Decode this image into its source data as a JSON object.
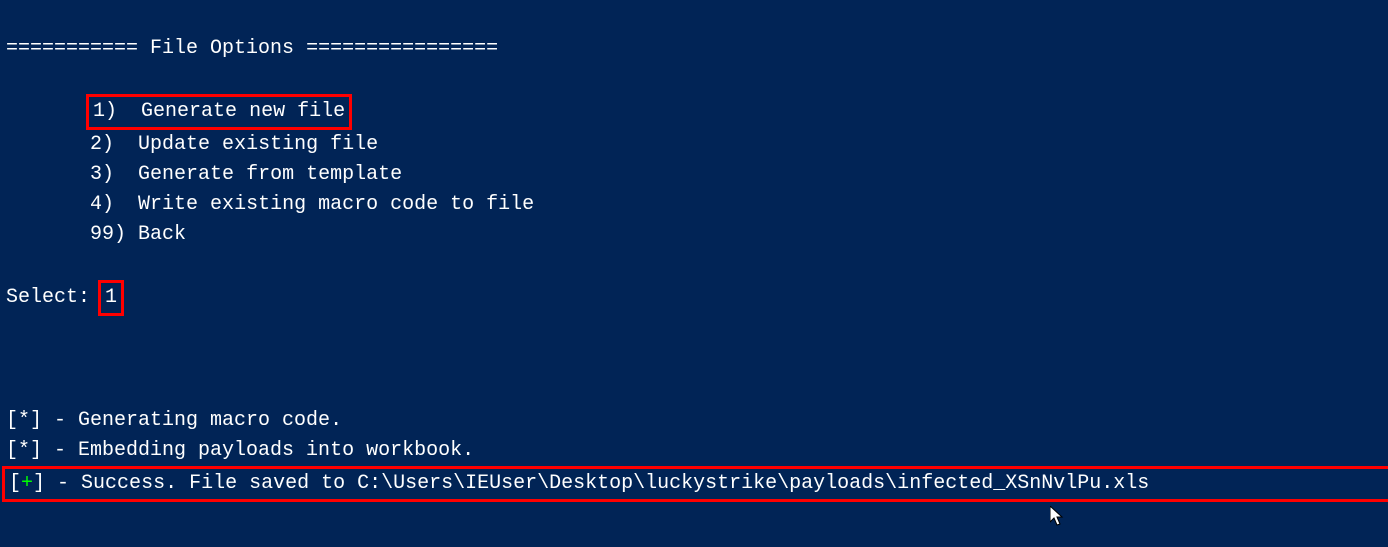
{
  "header": {
    "eq_left": "===========",
    "title": " File Options ",
    "eq_right": "================"
  },
  "menu": {
    "item1": {
      "num": "1)",
      "label": "Generate new file"
    },
    "item2": {
      "num": "2)",
      "label": "Update existing file"
    },
    "item3": {
      "num": "3)",
      "label": "Generate from template"
    },
    "item4": {
      "num": "4)",
      "label": "Write existing macro code to file"
    },
    "item99": {
      "num": "99)",
      "label": "Back"
    }
  },
  "prompt": {
    "label": "Select:",
    "value": "1"
  },
  "status": {
    "line1": {
      "prefix": "[*]",
      "text": " - Generating macro code."
    },
    "line2": {
      "prefix": "[*]",
      "text": " - Embedding payloads into workbook."
    },
    "line3": {
      "bracket_open": "[",
      "plus": "+",
      "bracket_close": "]",
      "text": " - Success. File saved to C:\\Users\\IEUser\\Desktop\\luckystrike\\payloads\\infected_XSnNvlPu.xls"
    }
  },
  "cursor_name": "mouse-pointer"
}
